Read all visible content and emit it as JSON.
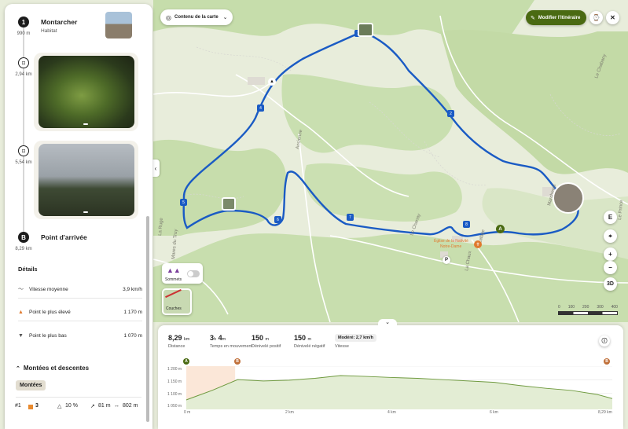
{
  "panel": {
    "stops": [
      {
        "badge": "1",
        "distance": "990 m",
        "title": "Montarcher",
        "subtitle": "Habitat"
      },
      {
        "distance": "2,94 km",
        "photo": "forest-photo"
      },
      {
        "distance": "5,54 km",
        "photo": "sky-photo"
      },
      {
        "badge": "B",
        "distance": "8,29 km",
        "title": "Point d'arrivée"
      }
    ],
    "details": {
      "heading": "Détails",
      "rows": [
        {
          "icon": "speed-icon",
          "label": "Vitesse moyenne",
          "value": "3,9 km/h"
        },
        {
          "icon": "up-triangle-icon",
          "label": "Point le plus élevé",
          "value": "1 170 m"
        },
        {
          "icon": "down-triangle-icon",
          "label": "Point le plus bas",
          "value": "1 070 m"
        }
      ]
    },
    "climbs": {
      "heading": "Montées et descentes",
      "chip": "Montées",
      "row": {
        "index": "#1",
        "level": "3",
        "grade": "10 %",
        "gain": "81 m",
        "length": "802 m"
      }
    }
  },
  "map": {
    "content_button": "Contenu de la carte",
    "edit_button": "Modifier l'itinéraire",
    "layer_summits": "Sommets",
    "layer_layers": "Couches",
    "compass": "E",
    "zoom_in": "+",
    "zoom_out": "−",
    "view_3d": "3D",
    "scale": [
      "0",
      "100",
      "200",
      "300",
      "400"
    ],
    "labels": [
      "Ancienne",
      "Le Chanay",
      "Le Truy",
      "La Ruge",
      "Mares du Truy",
      "Le Prince",
      "Église de la Nativité Notre-Dame",
      "La Chaux",
      "Lafaye",
      "Marcheval"
    ],
    "route_markers": [
      "1",
      "2",
      "3",
      "4",
      "5",
      "6",
      "7",
      "8"
    ],
    "colors": {
      "route": "#1a5bc4",
      "accent": "#4a6a12",
      "forest": "#c9dfb0",
      "meadow": "#e9eedd"
    }
  },
  "profile": {
    "stats": [
      {
        "value": "8,29",
        "unit": "km",
        "label": "Distance"
      },
      {
        "value": "3",
        "unit": "h",
        "value2": "4",
        "unit2": "m",
        "label": "Temps en mouvement"
      },
      {
        "value": "150",
        "unit": "m",
        "label": "Dénivelé positif"
      },
      {
        "value": "150",
        "unit": "m",
        "label": "Dénivelé négatif"
      },
      {
        "chip": "Modéré: 2,7 km/h",
        "label": "Vitesse"
      }
    ],
    "y_ticks": [
      "1 200 m",
      "1 150 m",
      "1 100 m",
      "1 050 m"
    ],
    "x_ticks": [
      "0 m",
      "2 km",
      "4 km",
      "6 km",
      "8,29 km"
    ],
    "markers": [
      "A",
      "B",
      "B"
    ]
  },
  "chart_data": {
    "type": "area",
    "title": "",
    "xlabel": "",
    "ylabel": "",
    "x": [
      0,
      0.5,
      1,
      1.5,
      2,
      2.5,
      3,
      3.5,
      4,
      4.5,
      5,
      5.5,
      6,
      6.5,
      7,
      7.5,
      8,
      8.29
    ],
    "y": [
      1075,
      1110,
      1150,
      1145,
      1148,
      1155,
      1165,
      1162,
      1158,
      1155,
      1150,
      1145,
      1140,
      1128,
      1118,
      1110,
      1095,
      1080
    ],
    "xlim": [
      0,
      8.29
    ],
    "ylim": [
      1040,
      1200
    ],
    "x_unit": "km",
    "y_unit": "m"
  }
}
